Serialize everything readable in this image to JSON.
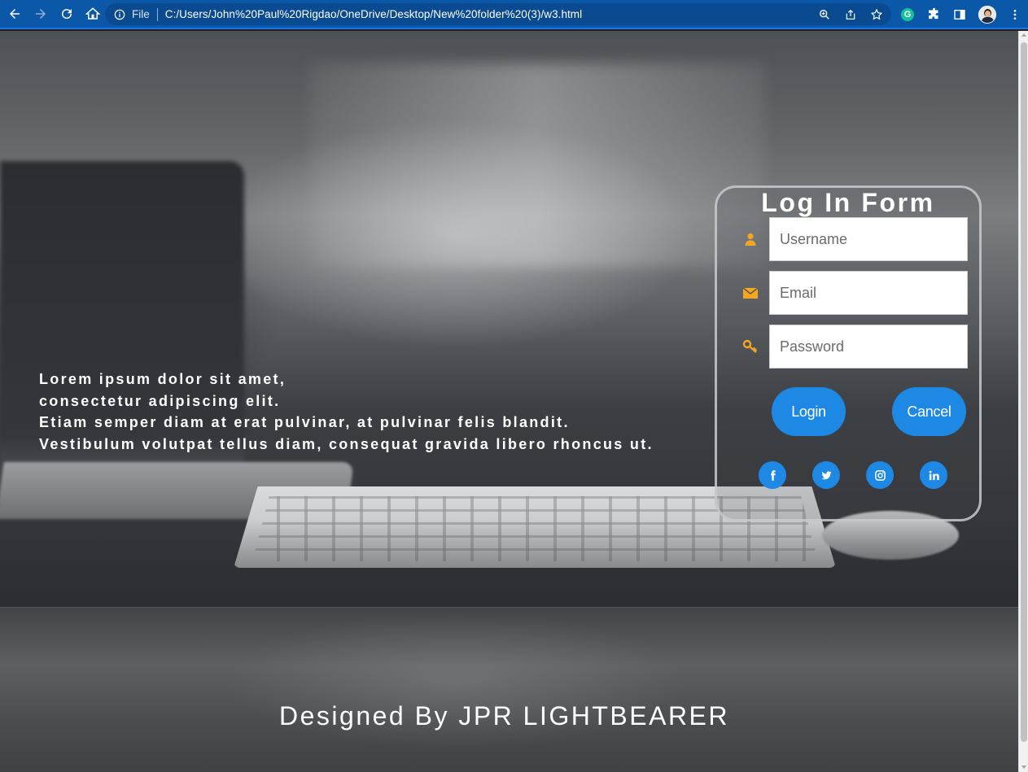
{
  "browser": {
    "file_label": "File",
    "url": "C:/Users/John%20Paul%20Rigdao/OneDrive/Desktop/New%20folder%20(3)/w3.html",
    "extension_badge": "G"
  },
  "hero": {
    "lines": [
      "Lorem ipsum dolor sit amet,",
      "consectetur adipiscing elit.",
      "Etiam semper diam at erat pulvinar, at pulvinar felis blandit.",
      "Vestibulum volutpat tellus diam, consequat gravida libero rhoncus ut."
    ]
  },
  "login": {
    "title": "Log In Form",
    "fields": [
      {
        "placeholder": "Username",
        "value": "",
        "icon": "user-icon"
      },
      {
        "placeholder": "Email",
        "value": "",
        "icon": "envelope-icon"
      },
      {
        "placeholder": "Password",
        "value": "",
        "icon": "key-icon"
      }
    ],
    "login_label": "Login",
    "cancel_label": "Cancel",
    "socials": [
      "facebook-icon",
      "twitter-icon",
      "instagram-icon",
      "linkedin-icon"
    ]
  },
  "footer": {
    "credit": "Designed By JPR LIGHTBEARER"
  },
  "colors": {
    "accent": "#1e88e5",
    "icon_orange": "#f5a623",
    "chrome": "#0b57a8"
  }
}
